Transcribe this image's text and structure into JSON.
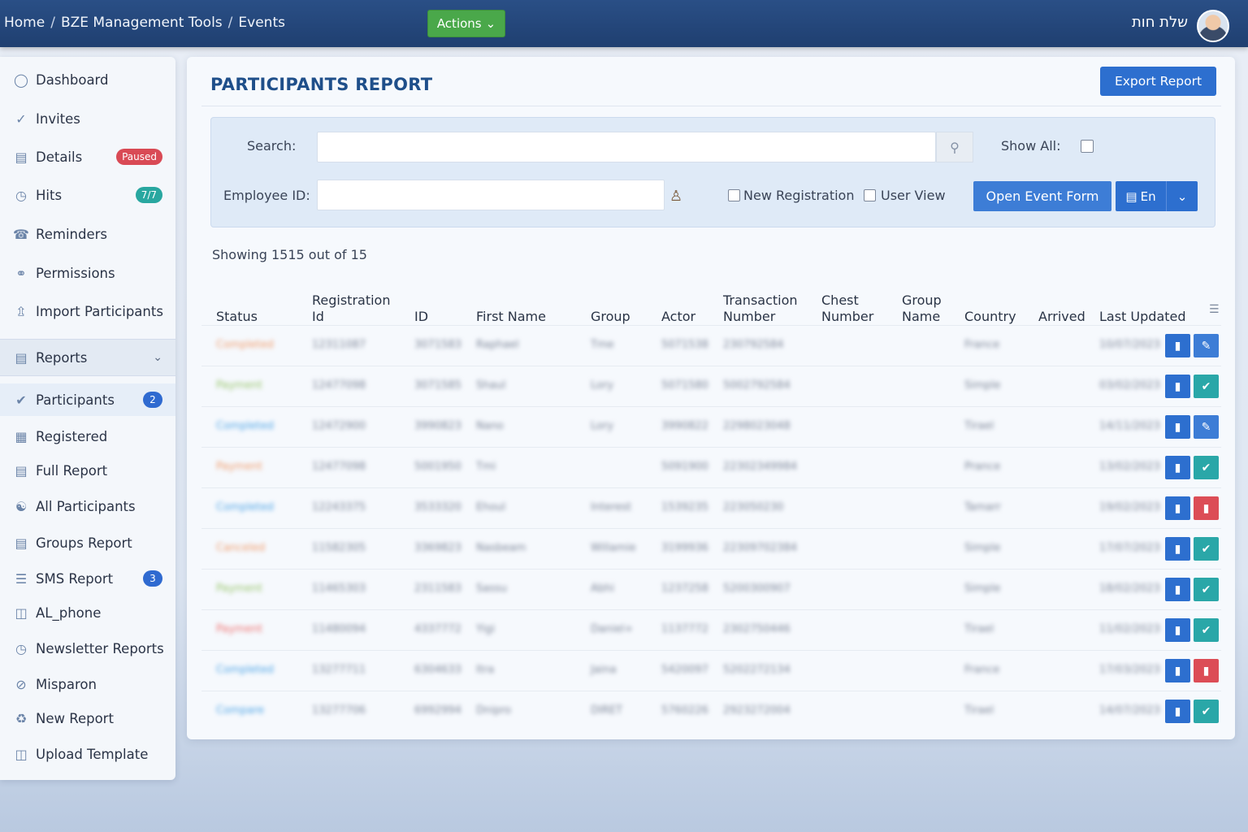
{
  "topbar": {
    "breadcrumb": [
      "Home",
      "BZE Management Tools",
      "Events"
    ],
    "breadcrumb_sep": "/",
    "actions_label": "Actions",
    "user_name": "שלת חות"
  },
  "sidebar": {
    "items": [
      {
        "label": "Dashboard",
        "icon": "dashboard-icon"
      },
      {
        "label": "Invites",
        "icon": "invites-icon"
      },
      {
        "label": "Details",
        "icon": "details-icon",
        "badge": "Paused",
        "badge_color": "#d94a55"
      },
      {
        "label": "Hits",
        "icon": "clock-icon",
        "badge": "7/7",
        "badge_color": "#28a7a0"
      },
      {
        "label": "Reminders",
        "icon": "bell-icon"
      },
      {
        "label": "Permissions",
        "icon": "lock-icon"
      },
      {
        "label": "Import Participants",
        "icon": "import-icon"
      }
    ],
    "reports_section": {
      "label": "Reports",
      "icon": "reports-icon"
    },
    "report_items": [
      {
        "label": "Participants",
        "icon": "check-circle-icon",
        "badge": "2",
        "badge_color": "#2f6ad0"
      },
      {
        "label": "Registered",
        "icon": "grid-icon"
      },
      {
        "label": "Full Report",
        "icon": "doc-icon"
      },
      {
        "label": "All Participants",
        "icon": "users-icon"
      },
      {
        "label": "Groups Report",
        "icon": "doc-icon"
      },
      {
        "label": "SMS Report",
        "icon": "list-icon",
        "badge": "3",
        "badge_color": "#2f6ad0"
      },
      {
        "label": "AL_phone",
        "icon": "phone-icon"
      },
      {
        "label": "Newsletter Reports",
        "icon": "newsletter-icon"
      },
      {
        "label": "Misparon",
        "icon": "misparon-icon"
      },
      {
        "label": "New Report",
        "icon": "new-report-icon"
      },
      {
        "label": "Upload Template",
        "icon": "upload-icon"
      }
    ]
  },
  "main": {
    "title": "PARTICIPANTS REPORT",
    "export_label": "Export Report",
    "filters": {
      "search_label": "Search:",
      "search_value": "",
      "show_all_label": "Show All:",
      "employee_label": "Employee ID:",
      "employee_value": "",
      "new_registration_label": "New Registration",
      "user_view_label": "User View",
      "open_event_form_label": "Open Event Form",
      "language_label": "En"
    },
    "showing_text": "Showing 1515 out of 15",
    "columns": [
      "Status",
      "Registration Id",
      "ID",
      "First Name",
      "Group",
      "Actor",
      "Transaction Number",
      "Chest Number",
      "Group Name",
      "Country",
      "Arrived",
      "Last Updated"
    ],
    "rows": [
      {
        "status": "Completed",
        "status_color": "#f09a6a",
        "reg_id": "12311087",
        "id": "3071583",
        "first_name": "Raphael",
        "group": "Tme",
        "actor": "5071538",
        "trans": "230792584",
        "country": "France",
        "updated": "10/07/2023",
        "action": "edit"
      },
      {
        "status": "Payment",
        "status_color": "#96c46a",
        "reg_id": "12477098",
        "id": "3071585",
        "first_name": "Shaul",
        "group": "Lory",
        "actor": "5071580",
        "trans": "5002792584",
        "country": "Simple",
        "updated": "03/02/2023",
        "action": "check"
      },
      {
        "status": "Completed",
        "status_color": "#4da3e6",
        "reg_id": "12472900",
        "id": "3990823",
        "first_name": "Nano",
        "group": "Lory",
        "actor": "3990822",
        "trans": "2298023048",
        "country": "Tirael",
        "updated": "14/11/2023",
        "action": "edit"
      },
      {
        "status": "Payment",
        "status_color": "#f09a6a",
        "reg_id": "12477098",
        "id": "5001950",
        "first_name": "Tmi",
        "group": "",
        "actor": "5091900",
        "trans": "22302349984",
        "country": "Prance",
        "updated": "13/02/2023",
        "action": "check"
      },
      {
        "status": "Completed",
        "status_color": "#4da3e6",
        "reg_id": "12243375",
        "id": "3533320",
        "first_name": "Ehoul",
        "group": "Interest",
        "actor": "1539235",
        "trans": "223050230",
        "country": "Tamarr",
        "updated": "19/02/2023",
        "action": "delete"
      },
      {
        "status": "Canceled",
        "status_color": "#f09a6a",
        "reg_id": "11582305",
        "id": "3369823",
        "first_name": "Nasbeam",
        "group": "Willamie",
        "actor": "3199936",
        "trans": "22309702384",
        "country": "Simple",
        "updated": "17/07/2023",
        "action": "check"
      },
      {
        "status": "Payment",
        "status_color": "#96c46a",
        "reg_id": "11465303",
        "id": "2311583",
        "first_name": "Sassu",
        "group": "Abhi",
        "actor": "1237258",
        "trans": "5200300907",
        "country": "Simple",
        "updated": "18/02/2023",
        "action": "check"
      },
      {
        "status": "Payment",
        "status_color": "#ef6f6f",
        "reg_id": "11480094",
        "id": "4337772",
        "first_name": "Yigi",
        "group": "Daniel+",
        "actor": "1137772",
        "trans": "2302750446",
        "country": "Tirael",
        "updated": "11/02/2023",
        "action": "check"
      },
      {
        "status": "Completed",
        "status_color": "#4da3e6",
        "reg_id": "13277711",
        "id": "6304633",
        "first_name": "Itra",
        "group": "Jaina",
        "actor": "5420097",
        "trans": "5202272134",
        "country": "France",
        "updated": "17/03/2023",
        "action": "delete"
      },
      {
        "status": "Compare",
        "status_color": "#4da3e6",
        "reg_id": "13277706",
        "id": "6992994",
        "first_name": "Dnipro",
        "group": "DIRET",
        "actor": "5760226",
        "trans": "2923272004",
        "country": "Tirael",
        "updated": "14/07/2023",
        "action": "check"
      }
    ]
  },
  "colors": {
    "topbar": "#21426f",
    "primary": "#2d6fcf",
    "actions_green": "#4aa84a",
    "title": "#1f4f8a"
  }
}
